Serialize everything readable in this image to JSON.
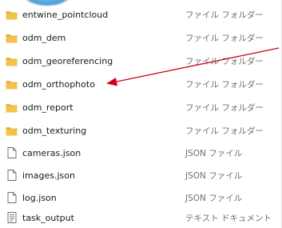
{
  "file_list": {
    "items": [
      {
        "name": "entwine_pointcloud",
        "type": "ファイル フォルダー",
        "icon": "folder-icon"
      },
      {
        "name": "odm_dem",
        "type": "ファイル フォルダー",
        "icon": "folder-icon"
      },
      {
        "name": "odm_georeferencing",
        "type": "ファイル フォルダー",
        "icon": "folder-icon"
      },
      {
        "name": "odm_orthophoto",
        "type": "ファイル フォルダー",
        "icon": "folder-icon"
      },
      {
        "name": "odm_report",
        "type": "ファイル フォルダー",
        "icon": "folder-icon"
      },
      {
        "name": "odm_texturing",
        "type": "ファイル フォルダー",
        "icon": "folder-icon"
      },
      {
        "name": "cameras.json",
        "type": "JSON ファイル",
        "icon": "file-icon"
      },
      {
        "name": "images.json",
        "type": "JSON ファイル",
        "icon": "file-icon"
      },
      {
        "name": "log.json",
        "type": "JSON ファイル",
        "icon": "file-icon"
      },
      {
        "name": "task_output",
        "type": "テキスト ドキュメント",
        "icon": "text-document-icon"
      }
    ]
  },
  "annotation": {
    "arrow_color": "#d0021b",
    "points_to": "odm_orthophoto"
  },
  "colors": {
    "folder": "#f2c24a",
    "folder_dark": "#dca72c",
    "accent_arc": "#4f9fd8"
  }
}
